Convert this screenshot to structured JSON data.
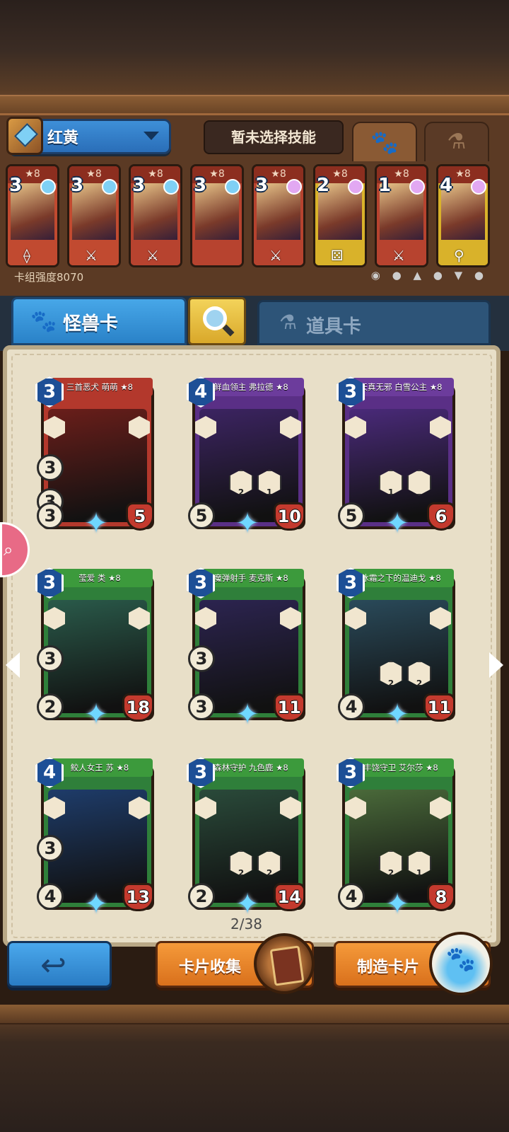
{
  "deck": {
    "name": "红黄",
    "skill_status": "暂未选择技能",
    "strength": "卡组强度8070",
    "tribe_icons": "◉ ● ▲ ● ▼ ●",
    "cards": [
      {
        "cost": "3",
        "stars": "★8",
        "gem": "#7fd0f5",
        "weapon": "bow",
        "color": "#c14a30"
      },
      {
        "cost": "3",
        "stars": "★8",
        "gem": "#7fd0f5",
        "weapon": "sword",
        "color": "#c14a30"
      },
      {
        "cost": "3",
        "stars": "★8",
        "gem": "#7fd0f5",
        "weapon": "sword",
        "color": "#b7432f"
      },
      {
        "cost": "3",
        "stars": "★8",
        "gem": "#7fd0f5",
        "weapon": "",
        "color": "#b7432f"
      },
      {
        "cost": "3",
        "stars": "★8",
        "gem": "#e2a8f2",
        "weapon": "sword",
        "color": "#b7432f"
      },
      {
        "cost": "2",
        "stars": "★8",
        "gem": "#e2a8f2",
        "weapon": "dice",
        "color": "#d9b22a"
      },
      {
        "cost": "1",
        "stars": "★8",
        "gem": "#e2a8f2",
        "weapon": "sword",
        "color": "#b7432f"
      },
      {
        "cost": "4",
        "stars": "★8",
        "gem": "#e2a8f2",
        "weapon": "hook",
        "color": "#d9b22a"
      }
    ]
  },
  "tabs": {
    "monster": "怪兽卡",
    "item": "道具卡"
  },
  "cards": [
    {
      "name": "三首恶犬 萌萌 ★8",
      "cost": "3",
      "hp": "5",
      "atk": "3",
      "left_stats": [
        "3",
        "3"
      ],
      "banner": "#b3382c",
      "frame": "#b3382c",
      "art": "#6a1e1a"
    },
    {
      "name": "鲜血领主 弗拉德 ★8",
      "cost": "4",
      "hp": "10",
      "atk": "5",
      "skills": [
        "2",
        "1"
      ],
      "banner": "#6c3c9c",
      "frame": "#5a2f86",
      "art": "#3c2462"
    },
    {
      "name": "天真无邪 白雪公主 ★8",
      "cost": "3",
      "hp": "6",
      "atk": "5",
      "skills": [
        "1",
        ""
      ],
      "banner": "#6c3c9c",
      "frame": "#5a2f86",
      "art": "#4a2a7a"
    },
    {
      "name": "莹爱 类 ★8",
      "cost": "3",
      "hp": "18",
      "atk": "2",
      "left_stats": [
        "3"
      ],
      "banner": "#3c9a3c",
      "frame": "#2f7f3a",
      "art": "#2a5a4a"
    },
    {
      "name": "魔弹射手 麦克斯 ★8",
      "cost": "3",
      "hp": "11",
      "atk": "3",
      "left_stats": [
        "3"
      ],
      "banner": "#3c9a3c",
      "frame": "#2f7f3a",
      "art": "#2c2450"
    },
    {
      "name": "冰霜之下的温迪戈 ★8",
      "cost": "3",
      "hp": "11",
      "atk": "4",
      "skills": [
        "2",
        "2"
      ],
      "banner": "#3c9a3c",
      "frame": "#2f7f3a",
      "art": "#2a4a5a"
    },
    {
      "name": "鲛人女王 苏 ★8",
      "cost": "4",
      "hp": "13",
      "atk": "4",
      "left_stats": [
        "3"
      ],
      "banner": "#3c9a3c",
      "frame": "#2f7f3a",
      "art": "#1e3c6a"
    },
    {
      "name": "森林守护 九色鹿 ★8",
      "cost": "3",
      "hp": "14",
      "atk": "2",
      "skills": [
        "2",
        "2"
      ],
      "banner": "#3c9a3c",
      "frame": "#2f7f3a",
      "art": "#2a4a3a"
    },
    {
      "name": "丰饶守卫 艾尔莎 ★8",
      "cost": "3",
      "hp": "8",
      "atk": "4",
      "skills": [
        "2",
        "1"
      ],
      "banner": "#3c9a3c",
      "frame": "#2f7f3a",
      "art": "#4a6a3a"
    }
  ],
  "pagination": "2/38",
  "buttons": {
    "collect": "卡片收集",
    "craft": "制造卡片",
    "search_side": "🔍"
  }
}
